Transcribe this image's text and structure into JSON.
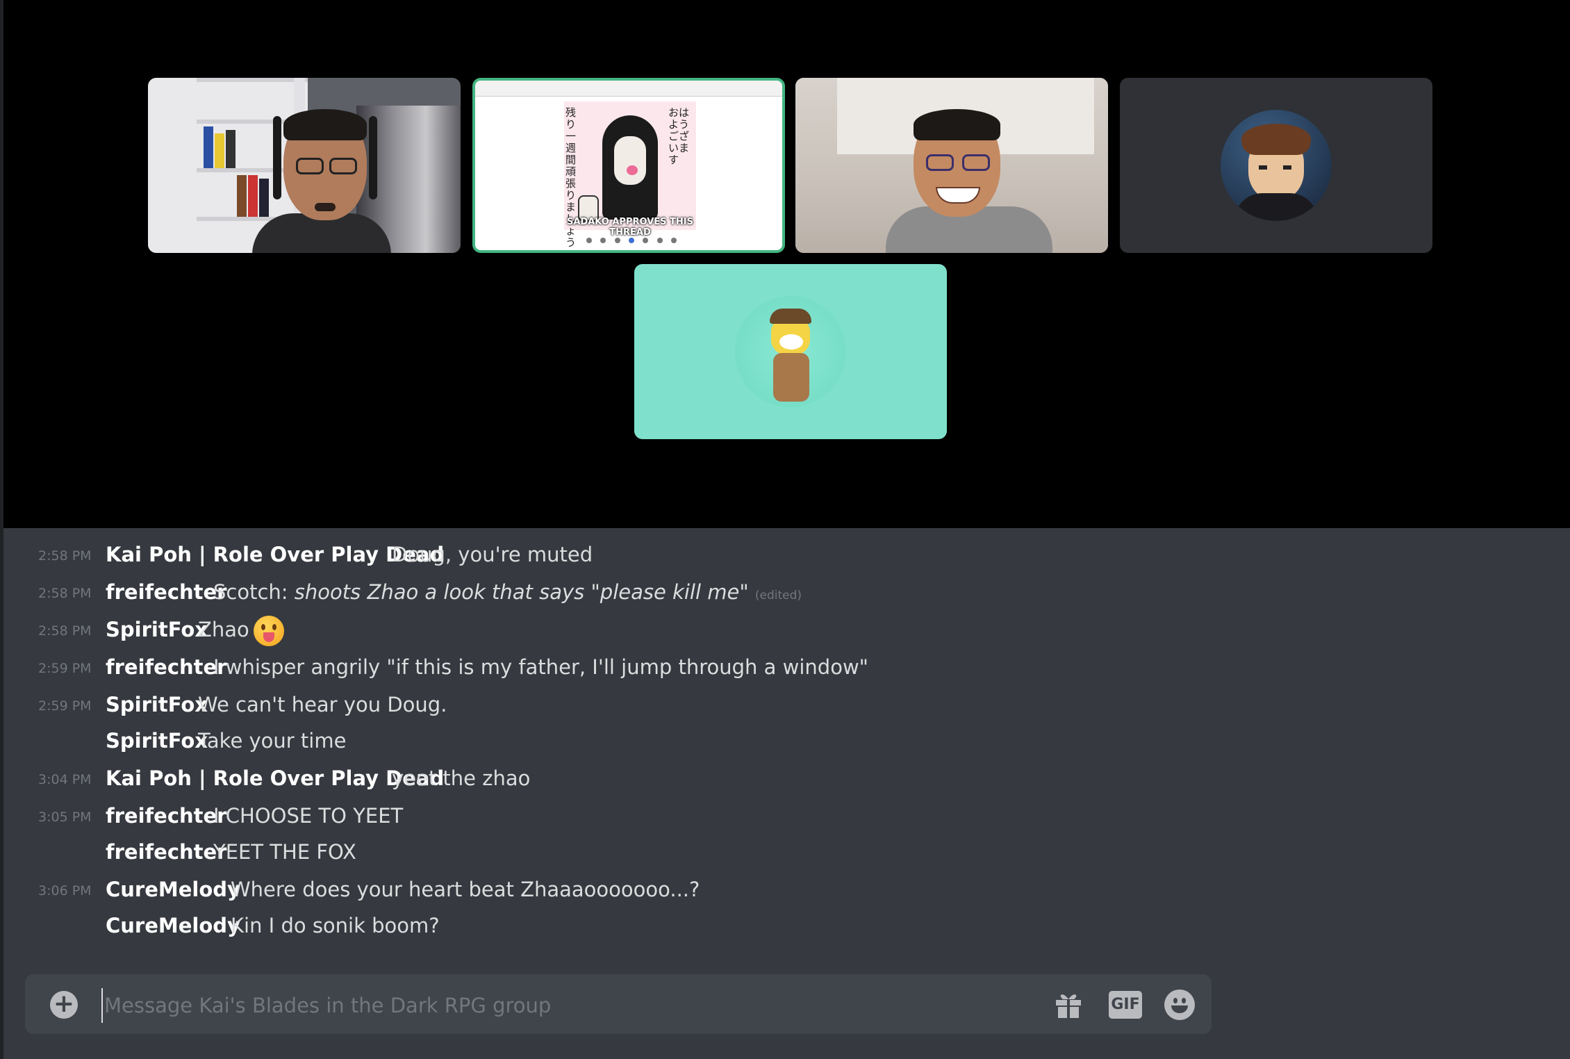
{
  "video": {
    "participants": [
      {
        "kind": "webcam",
        "name": ""
      },
      {
        "kind": "screen-share",
        "caption": "SADAKO APPROVES THIS THREAD",
        "japanese_text": "おはようございます。貞子です。残り一週間頑張りましょう。"
      },
      {
        "kind": "webcam",
        "name": ""
      },
      {
        "kind": "avatar",
        "name": ""
      },
      {
        "kind": "avatar",
        "name": ""
      }
    ],
    "active_speaker_color": "#43b581"
  },
  "messages": [
    {
      "time": "2:58 PM",
      "author": "Kai Poh | Role Over Play Dead",
      "text": "Doug, you're muted"
    },
    {
      "time": "2:58 PM",
      "author": "freifechter",
      "text_prefix": "Scotch: ",
      "text_italic": "shoots Zhao a look that says \"please kill me\"",
      "edited": "(edited)"
    },
    {
      "time": "2:58 PM",
      "author": "SpiritFox",
      "text": "Zhao",
      "emoji": "tongue-out-face"
    },
    {
      "time": "2:59 PM",
      "author": "freifechter",
      "text": "I whisper angrily \"if this is my father, I'll jump through a window\""
    },
    {
      "time": "2:59 PM",
      "author": "SpiritFox",
      "text": "We can't hear you Doug."
    },
    {
      "time": "",
      "author": "SpiritFox",
      "text": "Take your time"
    },
    {
      "time": "3:04 PM",
      "author": "Kai Poh | Role Over Play Dead",
      "text": "yeet the zhao"
    },
    {
      "time": "3:05 PM",
      "author": "freifechter",
      "text": "I CHOOSE TO YEET"
    },
    {
      "time": "",
      "author": "freifechter",
      "text": "YEET THE FOX"
    },
    {
      "time": "3:06 PM",
      "author": "CureMelody",
      "text": "Where does your heart beat Zhaaaooooooo...?"
    },
    {
      "time": "",
      "author": "CureMelody",
      "text": "Kin I do sonik boom?"
    }
  ],
  "composer": {
    "placeholder": "Message Kai's Blades in the Dark RPG group",
    "add_icon": "plus-circle-icon",
    "gift_icon": "gift-icon",
    "gif_label": "GIF",
    "emoji_icon": "smile-emoji-icon"
  }
}
